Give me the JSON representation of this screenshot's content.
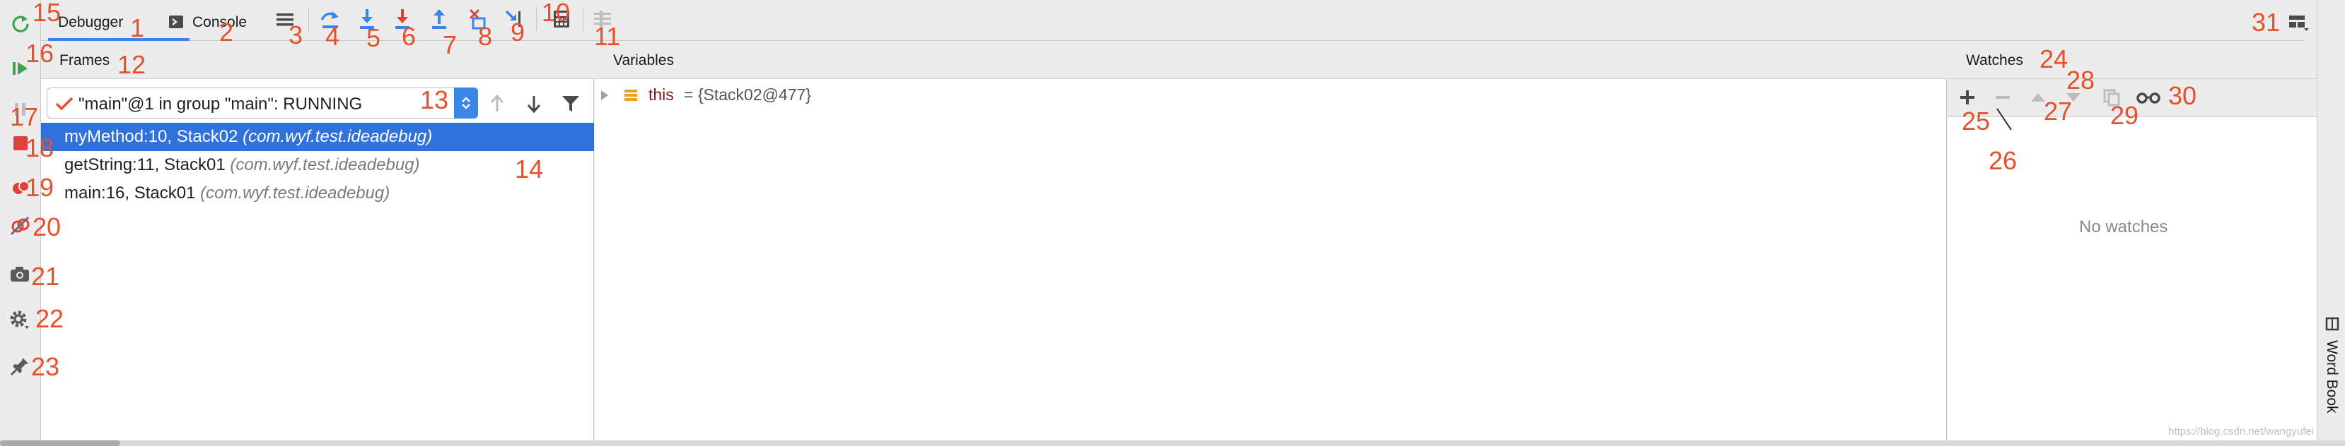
{
  "toolbar": {
    "tabs": {
      "debugger": "Debugger",
      "console": "Console"
    }
  },
  "frames": {
    "title": "Frames",
    "thread": "\"main\"@1 in group \"main\": RUNNING",
    "rows": [
      {
        "method": "myMethod:10, Stack02",
        "pkg": "(com.wyf.test.ideadebug)"
      },
      {
        "method": "getString:11, Stack01",
        "pkg": "(com.wyf.test.ideadebug)"
      },
      {
        "method": "main:16, Stack01",
        "pkg": "(com.wyf.test.ideadebug)"
      }
    ]
  },
  "variables": {
    "title": "Variables",
    "items": [
      {
        "name": "this",
        "value": "= {Stack02@477}"
      }
    ]
  },
  "watches": {
    "title": "Watches",
    "empty": "No watches"
  },
  "side": {
    "word_book": "Word Book"
  },
  "watermark": "https://blog.csdn.net/wangyufei",
  "annotations": {
    "n1": "1",
    "n2": "2",
    "n3": "3",
    "n4": "4",
    "n5": "5",
    "n6": "6",
    "n7": "7",
    "n8": "8",
    "n9": "9",
    "n10": "10",
    "n11": "11",
    "n12": "12",
    "n13": "13",
    "n14": "14",
    "n15": "15",
    "n16": "16",
    "n17": "17",
    "n18": "18",
    "n19": "19",
    "n20": "20",
    "n21": "21",
    "n22": "22",
    "n23": "23",
    "n24": "24",
    "n25": "25",
    "n26": "26",
    "n27": "27",
    "n28": "28",
    "n29": "29",
    "n30": "30",
    "n31": "31"
  },
  "colors": {
    "selection": "#2f72dc",
    "annotation": "#e8502c",
    "green": "#3fa34d",
    "red": "#e0403a",
    "blue": "#3a86e8"
  }
}
